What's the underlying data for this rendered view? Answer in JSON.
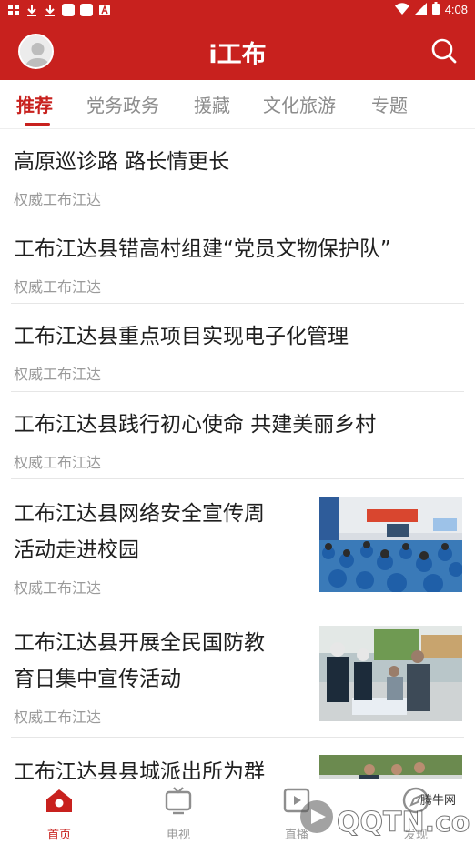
{
  "status_bar": {
    "time": "4:08"
  },
  "header": {
    "title": "i工布"
  },
  "tabs": [
    {
      "label": "推荐"
    },
    {
      "label": "党务政务"
    },
    {
      "label": "援藏"
    },
    {
      "label": "文化旅游"
    },
    {
      "label": "专题"
    }
  ],
  "feed": [
    {
      "title": "高原巡诊路 路长情更长",
      "source": "权威工布江达"
    },
    {
      "title": "工布江达县错高村组建“党员文物保护队”",
      "source": "权威工布江达"
    },
    {
      "title": "工布江达县重点项目实现电子化管理",
      "source": "权威工布江达"
    },
    {
      "title": "工布江达县践行初心使命 共建美丽乡村",
      "source": "权威工布江达"
    },
    {
      "title_line1": "工布江达县网络安全宣传周",
      "title_line2": "活动走进校园",
      "source": "权威工布江达",
      "image_icon": "classroom-photo"
    },
    {
      "title_line1": "工布江达县开展全民国防教",
      "title_line2": "育日集中宣传活动",
      "source": "权威工布江达",
      "image_icon": "street-promotion-photo"
    },
    {
      "title_line1": "工布江达县县城派出所为群",
      "image_icon": "crowd-photo"
    }
  ],
  "bottom_nav": [
    {
      "label": "首页",
      "icon": "home-icon"
    },
    {
      "label": "电视",
      "icon": "tv-icon"
    },
    {
      "label": "直播",
      "icon": "video-icon"
    },
    {
      "label": "发现",
      "icon": "compass-icon"
    }
  ],
  "watermark": {
    "brand": "腾牛网",
    "text": "QQTN.com"
  },
  "colors": {
    "brand_red": "#c8211e",
    "text_dark": "#1f1f1f",
    "text_grey": "#9a9a9a"
  }
}
